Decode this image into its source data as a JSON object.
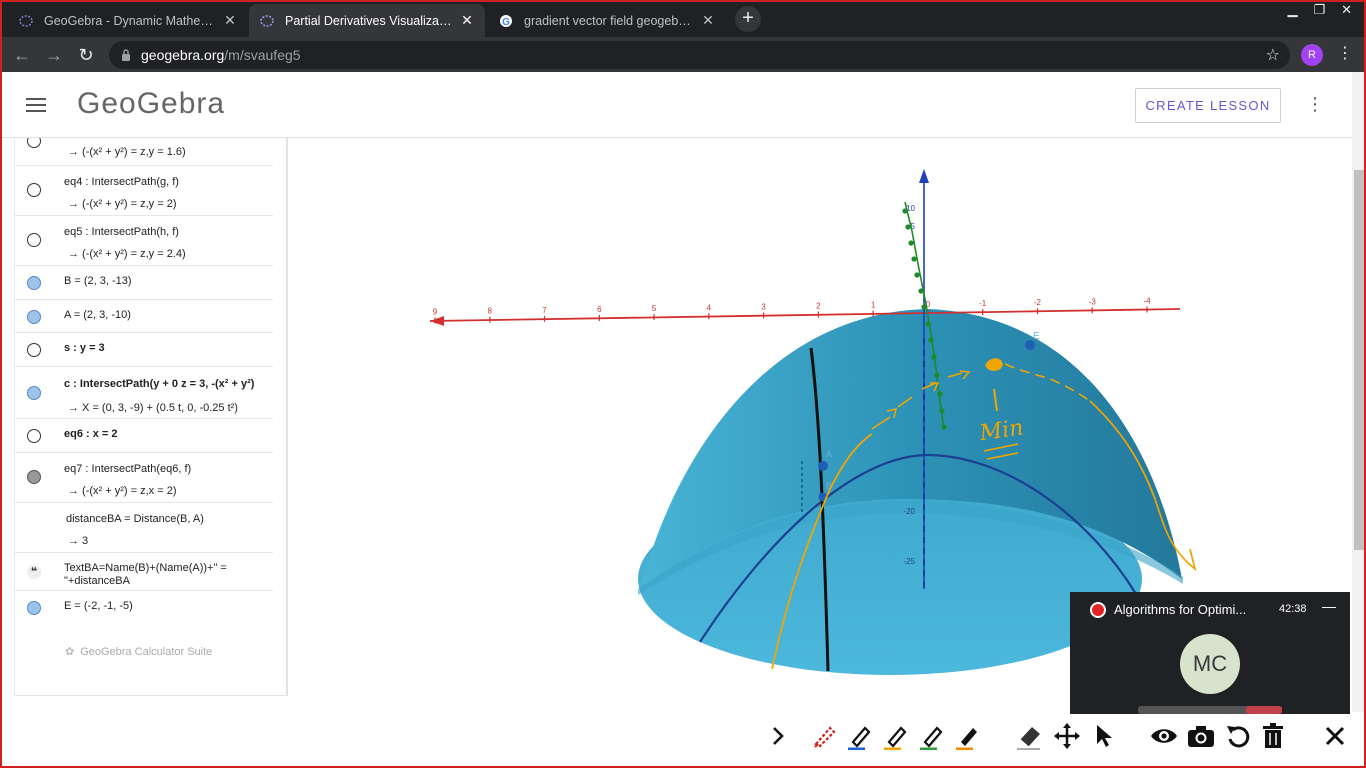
{
  "browser": {
    "tabs": [
      {
        "title": "GeoGebra - Dynamic Mathematics",
        "active": false,
        "icon": "geogebra-icon"
      },
      {
        "title": "Partial Derivatives Visualization 2",
        "active": true,
        "icon": "geogebra-icon"
      },
      {
        "title": "gradient vector field geogebra - Google",
        "active": false,
        "icon": "google-icon"
      }
    ],
    "url_host": "geogebra.org",
    "url_path": "/m/svaufeg5",
    "profile_initial": "R"
  },
  "header": {
    "logo": "GeoGebra",
    "create_lesson": "CREATE LESSON"
  },
  "algebra": {
    "rows": [
      {
        "kind": "def",
        "marker": "empty",
        "definition": "",
        "value": "→ (-(x² + y²) = z,y = 1.6)"
      },
      {
        "kind": "def",
        "marker": "empty",
        "definition": "eq4 : IntersectPath(g, f)",
        "value": "→ (-(x² + y²) = z,y = 2)"
      },
      {
        "kind": "def",
        "marker": "empty",
        "definition": "eq5 : IntersectPath(h, f)",
        "value": "→ (-(x² + y²) = z,y = 2.4)"
      },
      {
        "kind": "plain",
        "marker": "filled",
        "text": "B = (2, 3, -13)"
      },
      {
        "kind": "plain",
        "marker": "filled",
        "text": "A = (2, 3, -10)"
      },
      {
        "kind": "plain",
        "marker": "empty",
        "text": "s : y = 3"
      },
      {
        "kind": "def",
        "marker": "filled",
        "definition": "c : IntersectPath(y + 0 z = 3, -(x² + y²)",
        "value": "→ X = (0, 3, -9) + (0.5 t, 0, -0.25 t²)"
      },
      {
        "kind": "plain",
        "marker": "empty",
        "text": "eq6 : x = 2"
      },
      {
        "kind": "def",
        "marker": "gray",
        "definition": "eq7 : IntersectPath(eq6, f)",
        "value": "→ (-(x² + y²) = z,x = 2)"
      },
      {
        "kind": "def",
        "marker": "none",
        "definition": "distanceBA = Distance(B, A)",
        "value": "→ 3"
      },
      {
        "kind": "text",
        "marker": "quote",
        "line1": "TextBA=Name(B)+(Name(A))+\" =",
        "line2": "\"+distanceBA"
      },
      {
        "kind": "plain",
        "marker": "filled",
        "text": "E = (-2, -1, -5)"
      }
    ],
    "footer": "GeoGebra Calculator Suite"
  },
  "graph3d": {
    "x_ticks": [
      "9",
      "8",
      "7",
      "6",
      "5",
      "4",
      "3",
      "2",
      "1",
      "0",
      "-1",
      "-2",
      "-3",
      "-4"
    ],
    "z_ticks": [
      "10",
      "5",
      "-20",
      "-25"
    ],
    "point_labels": [
      "A",
      "B",
      "E"
    ],
    "annotation": "Min",
    "colors": {
      "surface": "#2e8fb4",
      "axis_x": "#d32f2f",
      "axis_z": "#1f3fbf",
      "ink": "#f0a500",
      "gradient": "#1e8a2a"
    }
  },
  "pip": {
    "title": "Algorithms for Optimi...",
    "time": "42:38",
    "initials": "MC"
  },
  "toolbar": {
    "tools": [
      "chevron-right-icon",
      "red-pen-icon",
      "blue-pen-icon",
      "orange-pen-icon",
      "green-pen-icon",
      "highlighter-icon",
      "eraser-icon",
      "move-icon",
      "pointer-icon",
      "eye-icon",
      "camera-icon",
      "undo-icon",
      "trash-icon",
      "close-icon"
    ]
  }
}
